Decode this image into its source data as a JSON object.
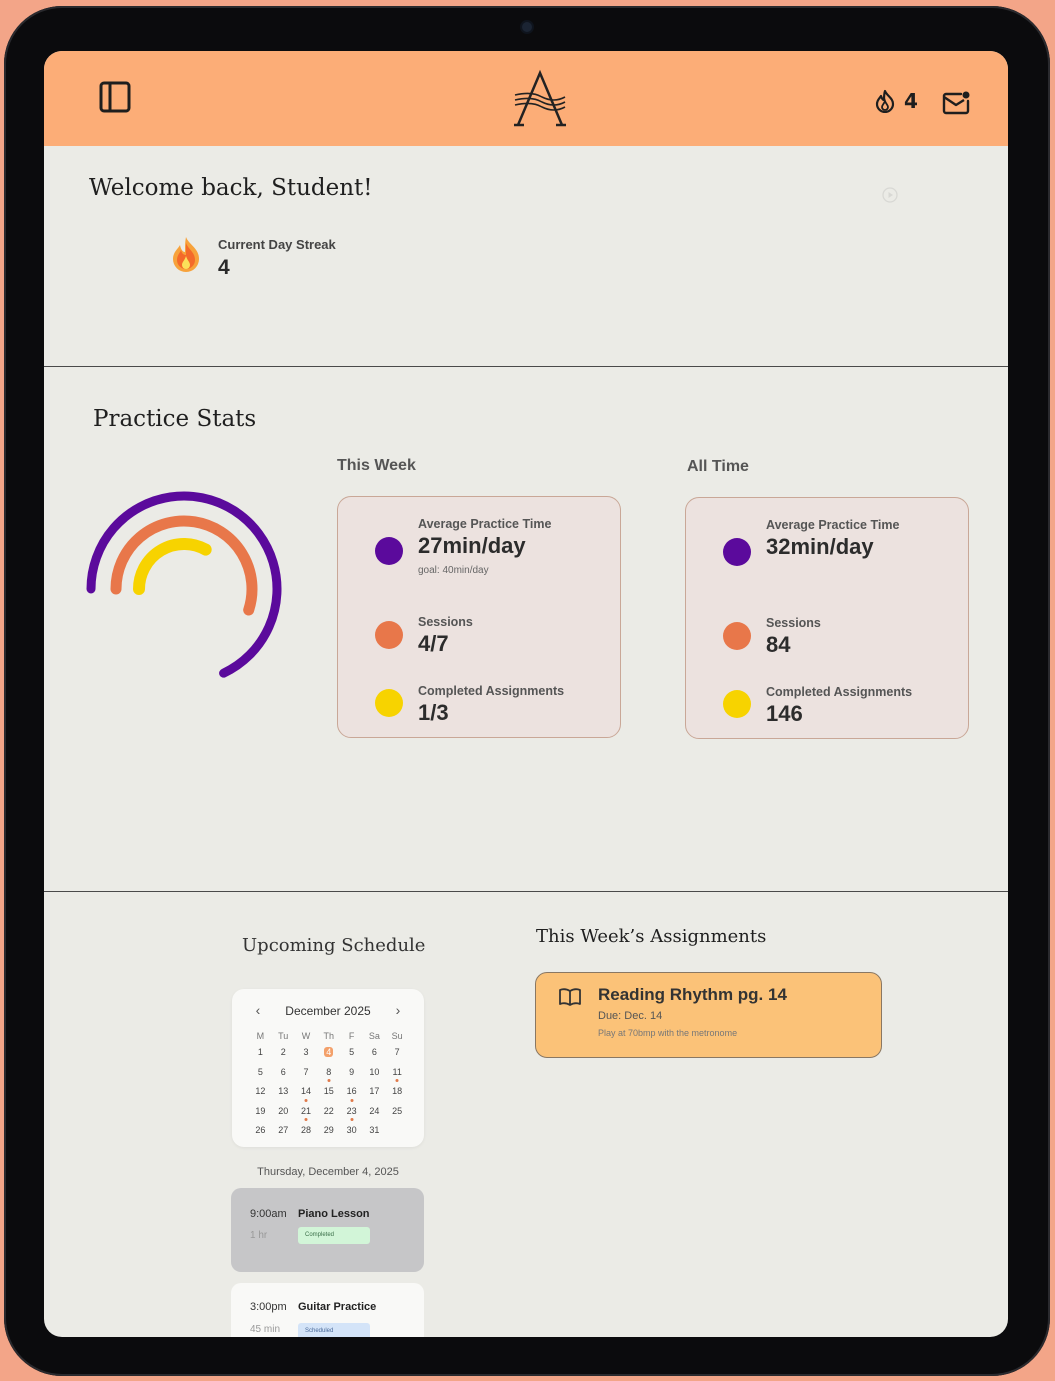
{
  "header": {
    "streak_count": "4",
    "colors": {
      "bar": "#fcad77"
    }
  },
  "welcome": {
    "title": "Welcome back, Student!",
    "streak_label": "Current Day Streak",
    "streak_value": "4"
  },
  "practice_stats": {
    "title": "Practice Stats",
    "ring_progress": {
      "purple": 0.68,
      "orange": 0.55,
      "yellow": 0.33
    },
    "this_week": {
      "title": "This Week",
      "avg_label": "Average Practice Time",
      "avg_value": "27min/day",
      "goal": "goal: 40min/day",
      "sessions_label": "Sessions",
      "sessions_value": "4/7",
      "assign_label": "Completed Assignments",
      "assign_value": "1/3"
    },
    "all_time": {
      "title": "All Time",
      "avg_label": "Average Practice Time",
      "avg_value": "32min/day",
      "sessions_label": "Sessions",
      "sessions_value": "84",
      "assign_label": "Completed Assignments",
      "assign_value": "146"
    },
    "colors": {
      "purple": "#5b0a9c",
      "orange": "#e8774a",
      "yellow": "#f7d300"
    }
  },
  "schedule": {
    "title": "Upcoming Schedule",
    "calendar": {
      "month": "December 2025",
      "prev": "‹",
      "next": "›",
      "day_headers": [
        "M",
        "Tu",
        "W",
        "Th",
        "F",
        "Sa",
        "Su"
      ],
      "weeks": [
        [
          "1",
          "2",
          "3",
          "4",
          "5",
          "6",
          "7"
        ],
        [
          "5",
          "6",
          "7",
          "8",
          "9",
          "10",
          "11"
        ],
        [
          "12",
          "13",
          "14",
          "15",
          "16",
          "17",
          "18"
        ],
        [
          "19",
          "20",
          "21",
          "22",
          "23",
          "24",
          "25"
        ],
        [
          "26",
          "27",
          "28",
          "29",
          "30",
          "31",
          ""
        ]
      ]
    },
    "date_heading": "Thursday, December 4, 2025",
    "events": [
      {
        "time": "9:00am",
        "name": "Piano Lesson",
        "duration": "1 hr",
        "status": "Completed"
      },
      {
        "time": "3:00pm",
        "name": "Guitar Practice",
        "duration": "45 min",
        "status": "Scheduled"
      }
    ]
  },
  "assignments": {
    "title": "This Week’s Assignments",
    "items": [
      {
        "title": "Reading Rhythm pg. 14",
        "due": "Due: Dec. 14",
        "note": "Play at 70bmp with the metronome"
      }
    ]
  }
}
